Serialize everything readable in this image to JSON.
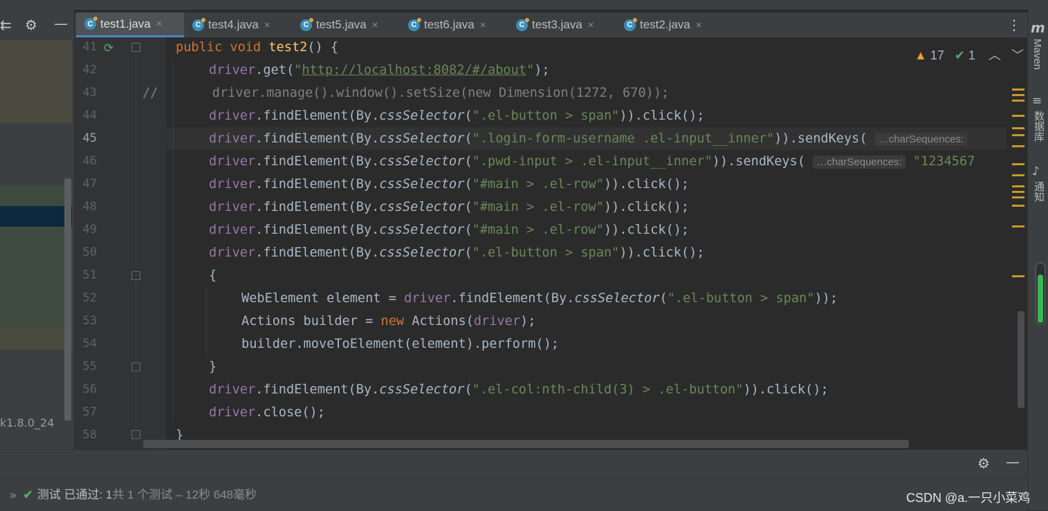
{
  "tabs": [
    {
      "label": "test1.java",
      "active": true
    },
    {
      "label": "test4.java",
      "active": false
    },
    {
      "label": "test5.java",
      "active": false
    },
    {
      "label": "test6.java",
      "active": false
    },
    {
      "label": "test3.java",
      "active": false
    },
    {
      "label": "test2.java",
      "active": false
    }
  ],
  "tab_icon_letter": "C",
  "tab_close_glyph": "×",
  "line_numbers": [
    "41",
    "42",
    "43",
    "44",
    "45",
    "46",
    "47",
    "48",
    "49",
    "50",
    "51",
    "52",
    "53",
    "54",
    "55",
    "56",
    "57",
    "58"
  ],
  "code_tokens": {
    "public": "public",
    "void": "void",
    "test2": "test2",
    "paren_open_brace": "() {",
    "driver": "driver",
    "get": ".get(",
    "q": "\"",
    "url": "http://localhost:8082/#/about",
    "close_semi": ");",
    "comment43": "//       driver.manage().window().setSize(new Dimension(1272, 670));",
    "find": ".findElement(By.",
    "css": "cssSelector",
    "open": "(",
    "s44": "\".el-button > span\"",
    "click": ")).click();",
    "s45": "\".login-form-username .el-input__inner\"",
    "send": ")).sendKeys(",
    "hint": "…charSequences:",
    "s46": "\".pwd-input > .el-input__inner\"",
    "s46b": "\"1234567",
    "s47": "\"#main > .el-row\"",
    "brace_open": "{",
    "brace_close": "}",
    "webel": "WebElement element = ",
    "find_plain": ".findElement(By.",
    "close_close_semi": "));",
    "actions": "Actions builder = ",
    "new": "new",
    "actions2": " Actions(",
    "driver_close": ");",
    "builder": "builder.moveToElement(element).perform();",
    "s56": "\".el-col:nth-child(3) > .el-button\"",
    "close_call": ".close();"
  },
  "inspection": {
    "warnings": "17",
    "checks": "1"
  },
  "left_panel_text": "k1.8.0_24",
  "right_sidebar": {
    "maven": "Maven",
    "database": "数据库",
    "notifications": "通知"
  },
  "status": {
    "prefix": "测试 已通过: 1",
    "rest": "共 1 个测试 – 12秒 648毫秒"
  },
  "watermark": "CSDN @a.一只小菜鸡",
  "colors": {
    "keyword": "#cc7832",
    "string": "#6a8759",
    "field": "#9876aa",
    "method_decl": "#ffc66d",
    "ok": "#59a869"
  }
}
